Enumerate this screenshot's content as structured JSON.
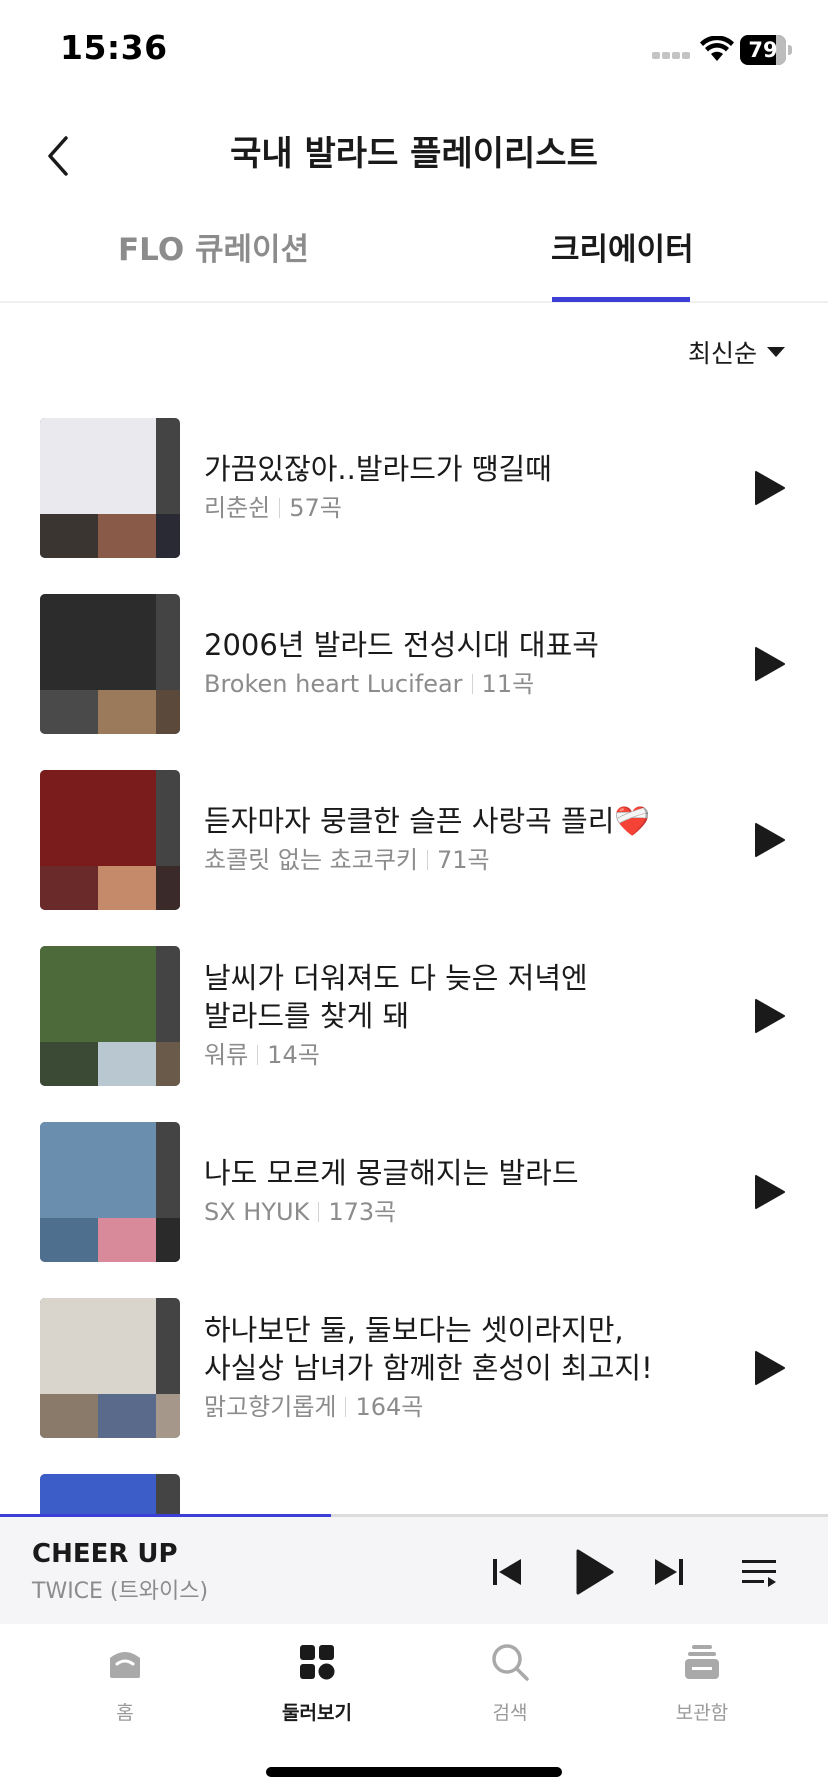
{
  "status_bar": {
    "time": "15:36",
    "battery": "79",
    "battery_fraction": 0.79
  },
  "header": {
    "title": "국내 발라드 플레이리스트",
    "back_icon": "chevron-left-icon"
  },
  "tabs": [
    {
      "label": "FLO 큐레이션",
      "active": false
    },
    {
      "label": "크리에이터",
      "active": true
    }
  ],
  "sort": {
    "label": "최신순",
    "icon": "caret-down-icon"
  },
  "playlists": [
    {
      "title": "가끔있잖아..발라드가 땡길때",
      "creator": "리춘쉰",
      "count": "57곡",
      "cover_colors": [
        "#e9e9ee",
        "#3a3530",
        "#8a5a48",
        "#2a2a35"
      ]
    },
    {
      "title": "2006년 발라드 전성시대 대표곡",
      "creator": "Broken heart Lucifear",
      "count": "11곡",
      "cover_colors": [
        "#2c2c2c",
        "#4a4a4a",
        "#9a7a5a",
        "#5b4a3c"
      ]
    },
    {
      "title": " 듣자마자 뭉클한  슬픈 사랑곡 플리❤️‍🩹",
      "creator": "쵸콜릿 없는 쵸코쿠키",
      "count": "71곡",
      "cover_colors": [
        "#7a1c1c",
        "#6b2a2a",
        "#c58a6a",
        "#3a2a2a"
      ]
    },
    {
      "title": "날씨가 더워져도 다 늦은 저녁엔\n발라드를 찾게 돼",
      "creator": "워류",
      "count": "14곡",
      "cover_colors": [
        "#4d6a3a",
        "#3b4a34",
        "#b9c7d1",
        "#6a5a4a"
      ]
    },
    {
      "title": "나도 모르게 몽글해지는 발라드",
      "creator": "SX HYUK",
      "count": "173곡",
      "cover_colors": [
        "#6a8eae",
        "#4f6f8f",
        "#d88a9a",
        "#2a2a2a"
      ]
    },
    {
      "title": "하나보단 둘, 둘보다는 셋이라지만,\n사실상 남녀가 함께한 혼성이 최고지!",
      "creator": "맑고향기롭게",
      "count": "164곡",
      "cover_colors": [
        "#d9d4cc",
        "#8a7a6a",
        "#5a6a8a",
        "#a5988a"
      ]
    },
    {
      "title": "",
      "creator": "",
      "count": "",
      "cover_colors": [
        "#3c5cc8",
        "#e6e6f0",
        "#444444",
        "#555555"
      ]
    }
  ],
  "mini_player": {
    "title": "CHEER UP",
    "artist": "TWICE (트와이스)",
    "progress": 0.4
  },
  "bottom_nav": [
    {
      "label": "홈",
      "icon": "home-icon",
      "active": false
    },
    {
      "label": "둘러보기",
      "icon": "grid-icon",
      "active": true
    },
    {
      "label": "검색",
      "icon": "search-icon",
      "active": false
    },
    {
      "label": "보관함",
      "icon": "library-icon",
      "active": false
    }
  ],
  "colors": {
    "accent": "#3c3fd6",
    "text": "#1a1a1a",
    "muted": "#8c8c8c"
  }
}
